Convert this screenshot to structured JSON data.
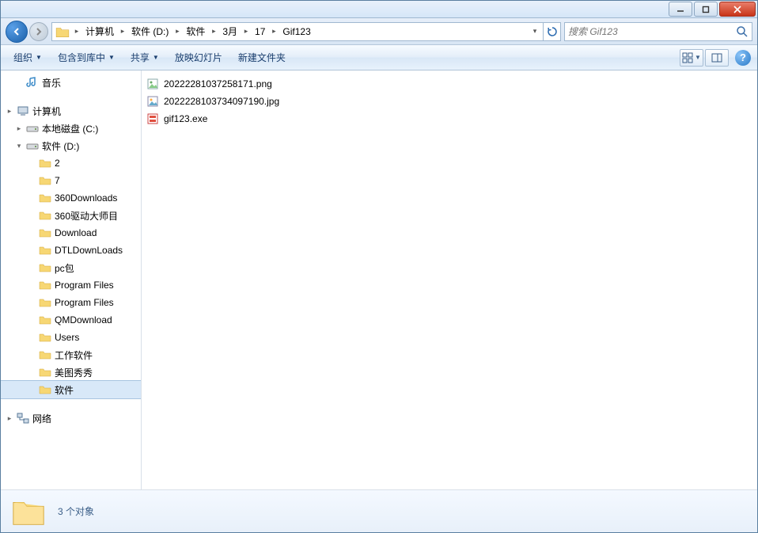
{
  "titlebar": {
    "min": "_",
    "max": "□",
    "close": "✕"
  },
  "breadcrumb": {
    "segments": [
      "计算机",
      "软件 (D:)",
      "软件",
      "3月",
      "17",
      "Gif123"
    ]
  },
  "search": {
    "placeholder": "搜索 Gif123"
  },
  "toolbar": {
    "organize": "组织",
    "include_lib": "包含到库中",
    "share": "共享",
    "slideshow": "放映幻灯片",
    "new_folder": "新建文件夹"
  },
  "sidebar": {
    "music": "音乐",
    "computer": "计算机",
    "drive_c": "本地磁盘 (C:)",
    "drive_d": "软件 (D:)",
    "folders": [
      "2",
      "7",
      "360Downloads",
      "360驱动大师目",
      "Download",
      "DTLDownLoads",
      "pc包",
      "Program Files",
      "Program Files",
      "QMDownload",
      "Users",
      "工作软件",
      "美图秀秀",
      "软件"
    ],
    "network": "网络"
  },
  "files": [
    {
      "name": "20222281037258171.png",
      "type": "png"
    },
    {
      "name": "2022228103734097190.jpg",
      "type": "jpg"
    },
    {
      "name": "gif123.exe",
      "type": "exe"
    }
  ],
  "details": {
    "count_label": "3 个对象"
  }
}
